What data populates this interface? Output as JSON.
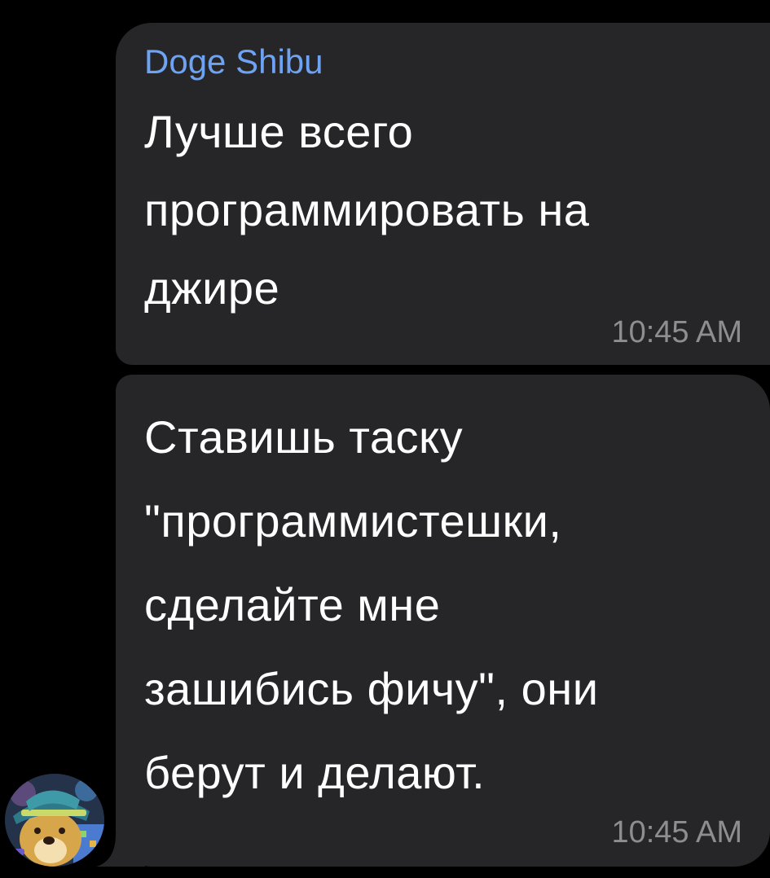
{
  "messages": [
    {
      "sender": "Doge Shibu",
      "text": "Лучше всего\nпрограммировать на\nджире",
      "time": "10:45 AM"
    },
    {
      "text": "Ставишь таску\n\"программистешки,\nсделайте мне\nзашибись фичу\", они\nберут и делают.",
      "time": "10:45 AM"
    }
  ],
  "colors": {
    "background": "#000000",
    "bubble": "#262628",
    "sender_name": "#6ea3f4",
    "timestamp": "#8d8d92",
    "text": "#ffffff"
  },
  "icons": {
    "avatar": "doge-avatar-icon"
  }
}
